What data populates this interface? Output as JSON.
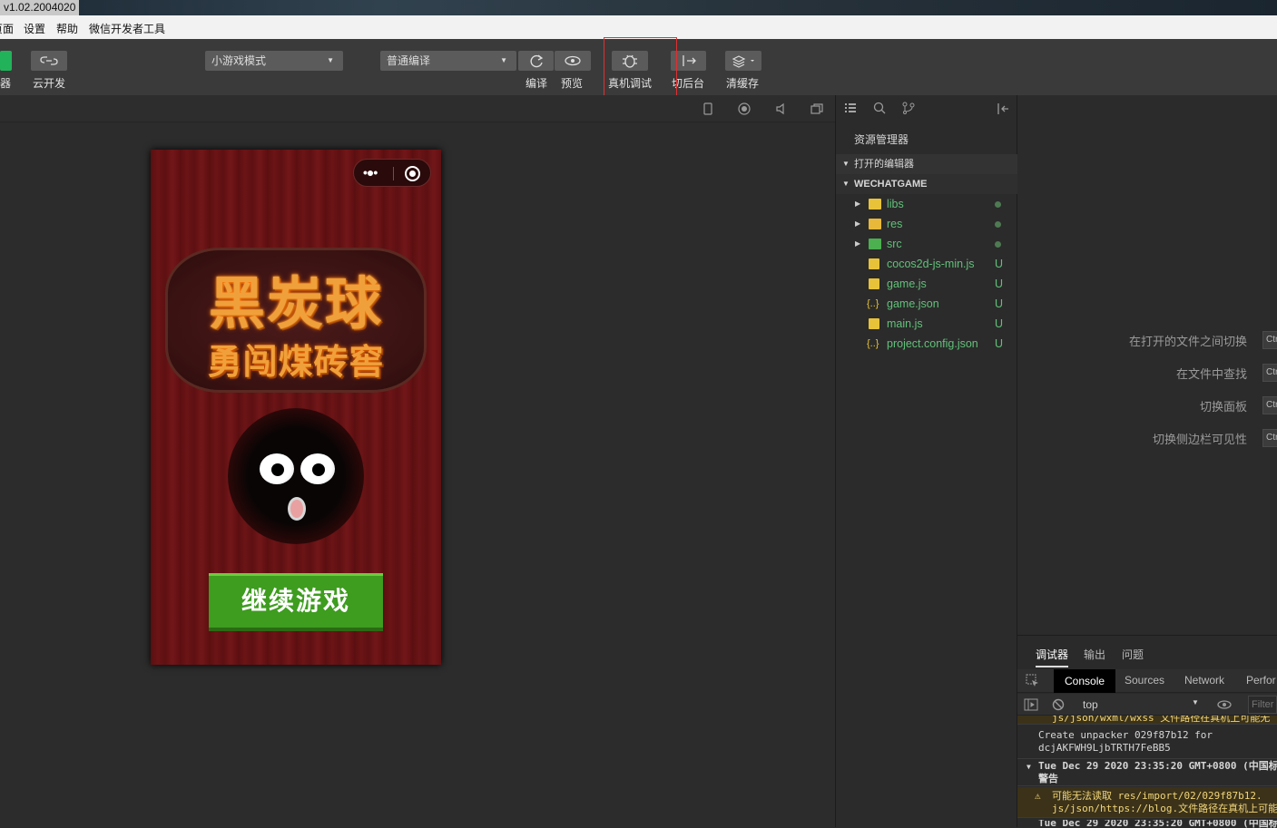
{
  "window": {
    "version": "v1.02.2004020"
  },
  "menu": {
    "items": [
      "页面",
      "设置",
      "帮助",
      "微信开发者工具"
    ]
  },
  "toolbar": {
    "left_label": "器",
    "cloud_label": "云开发",
    "mode_select": "小游戏模式",
    "compile_select": "普通编译",
    "compile_label": "编译",
    "preview_label": "预览",
    "remote_debug_label": "真机调试",
    "background_label": "切后台",
    "clear_cache_label": "清缓存"
  },
  "game": {
    "title_line1": "黑炭球",
    "title_line2": "勇闯煤砖窖",
    "continue_button": "继续游戏"
  },
  "explorer": {
    "title": "资源管理器",
    "open_editors": "打开的编辑器",
    "project": "WECHATGAME",
    "files": [
      {
        "name": "libs",
        "kind": "folder",
        "status": "dot"
      },
      {
        "name": "res",
        "kind": "folder",
        "status": "dot"
      },
      {
        "name": "src",
        "kind": "folder",
        "status": "dot"
      },
      {
        "name": "cocos2d-js-min.js",
        "kind": "js",
        "status": "U"
      },
      {
        "name": "game.js",
        "kind": "js",
        "status": "U"
      },
      {
        "name": "game.json",
        "kind": "json",
        "status": "U"
      },
      {
        "name": "main.js",
        "kind": "js",
        "status": "U"
      },
      {
        "name": "project.config.json",
        "kind": "json",
        "status": "U"
      }
    ]
  },
  "shortcuts": [
    {
      "label": "在打开的文件之间切换",
      "key": "Ctr"
    },
    {
      "label": "在文件中查找",
      "key": "Ctr"
    },
    {
      "label": "切换面板",
      "key": "Ctr"
    },
    {
      "label": "切换侧边栏可见性",
      "key": "Ctr"
    }
  ],
  "devtools": {
    "tabs": [
      "调试器",
      "输出",
      "问题"
    ],
    "console_tabs": [
      "Console",
      "Sources",
      "Network",
      "Perfor"
    ],
    "context": "top",
    "filter_placeholder": "Filter",
    "logs": {
      "line0": "js/json/wxml/wxss 文件路径在真机上可能无",
      "line1a": "Create unpacker 029f87b12 for",
      "line1b": "dcjAKFWH9LjbTRTH7FeBB5",
      "line2a": "Tue Dec 29 2020 23:35:20 GMT+0800 (中国标",
      "line2b": "警告",
      "line3a": "可能无法读取 res/import/02/029f87b12.",
      "line3b": "js/json/https://blog.文件路径在真机上可能无",
      "line4": "Tue Dec 29 2020 23:35:20 GMT+0800 (中国标"
    }
  },
  "colors": {
    "accent_green": "#3e9c1f",
    "highlight_red": "#e03030",
    "file_green": "#62c07a"
  }
}
